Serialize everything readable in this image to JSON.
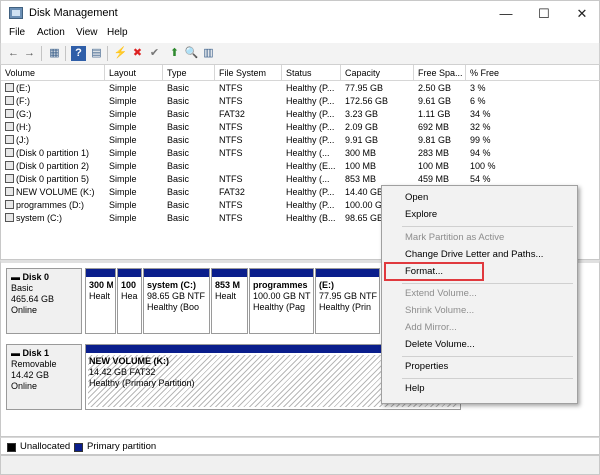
{
  "window": {
    "title": "Disk Management",
    "minimize": "—",
    "maximize": "☐",
    "close": "✕"
  },
  "menu": {
    "items": [
      "File",
      "Action",
      "View",
      "Help"
    ]
  },
  "toolbar": {
    "back": "←",
    "forward": "→",
    "grid": "▦",
    "help": "?",
    "props": "▤",
    "connect": "⚡",
    "delete": "✖",
    "check": "✔",
    "up": "⬆",
    "search": "🔍",
    "view": "▥"
  },
  "volume_list": {
    "headers": [
      "Volume",
      "Layout",
      "Type",
      "File System",
      "Status",
      "Capacity",
      "Free Spa...",
      "% Free"
    ],
    "rows": [
      [
        "(E:)",
        "Simple",
        "Basic",
        "NTFS",
        "Healthy (P...",
        "77.95 GB",
        "2.50 GB",
        "3 %"
      ],
      [
        "(F:)",
        "Simple",
        "Basic",
        "NTFS",
        "Healthy (P...",
        "172.56 GB",
        "9.61 GB",
        "6 %"
      ],
      [
        "(G:)",
        "Simple",
        "Basic",
        "FAT32",
        "Healthy (P...",
        "3.23 GB",
        "1.11 GB",
        "34 %"
      ],
      [
        "(H:)",
        "Simple",
        "Basic",
        "NTFS",
        "Healthy (P...",
        "2.09 GB",
        "692 MB",
        "32 %"
      ],
      [
        "(J:)",
        "Simple",
        "Basic",
        "NTFS",
        "Healthy (P...",
        "9.91 GB",
        "9.81 GB",
        "99 %"
      ],
      [
        "(Disk 0 partition 1)",
        "Simple",
        "Basic",
        "NTFS",
        "Healthy (...",
        "300 MB",
        "283 MB",
        "94 %"
      ],
      [
        "(Disk 0 partition 2)",
        "Simple",
        "Basic",
        "",
        "Healthy (E...",
        "100 MB",
        "100 MB",
        "100 %"
      ],
      [
        "(Disk 0 partition 5)",
        "Simple",
        "Basic",
        "NTFS",
        "Healthy (...",
        "853 MB",
        "459 MB",
        "54 %"
      ],
      [
        "NEW VOLUME (K:)",
        "Simple",
        "Basic",
        "FAT32",
        "Healthy (P...",
        "14.40 GB",
        "",
        ""
      ],
      [
        "programmes (D:)",
        "Simple",
        "Basic",
        "NTFS",
        "Healthy (P...",
        "100.00 G",
        "",
        ""
      ],
      [
        "system (C:)",
        "Simple",
        "Basic",
        "NTFS",
        "Healthy (B...",
        "98.65 GB",
        "",
        ""
      ]
    ]
  },
  "disk0": {
    "name": "Disk 0",
    "type": "Basic",
    "size": "465.64 GB",
    "status": "Online",
    "partitions": [
      {
        "l1": "300 M",
        "l2": "",
        "l3": "Healt"
      },
      {
        "l1": "100",
        "l2": "",
        "l3": "Hea"
      },
      {
        "l1": "system  (C:)",
        "l2": "98.65 GB NTF",
        "l3": "Healthy (Boo"
      },
      {
        "l1": "853 M",
        "l2": "",
        "l3": "Healt"
      },
      {
        "l1": "programmes",
        "l2": "100.00 GB NT",
        "l3": "Healthy (Pag"
      },
      {
        "l1": "(E:)",
        "l2": "77.95 GB NTF",
        "l3": "Healthy (Prin"
      },
      {
        "l1": "",
        "l2": "",
        "l3": ""
      }
    ]
  },
  "disk1": {
    "name": "Disk 1",
    "type": "Removable",
    "size": "14.42 GB",
    "status": "Online",
    "partition": {
      "l1": "NEW VOLUME  (K:)",
      "l2": "14.42 GB FAT32",
      "l3": "Healthy (Primary Partition)"
    }
  },
  "legend": {
    "unallocated": "Unallocated",
    "primary": "Primary partition",
    "unallocated_color": "#000000",
    "primary_color": "#0a1e8c"
  },
  "context_menu": {
    "items": [
      "Open",
      "Explore",
      "Mark Partition as Active",
      "Change Drive Letter and Paths...",
      "Format...",
      "Extend Volume...",
      "Shrink Volume...",
      "Add Mirror...",
      "Delete Volume...",
      "Properties",
      "Help"
    ],
    "disabled": [
      "Mark Partition as Active",
      "Extend Volume...",
      "Shrink Volume...",
      "Add Mirror..."
    ],
    "highlight_color": "#e0393e"
  }
}
